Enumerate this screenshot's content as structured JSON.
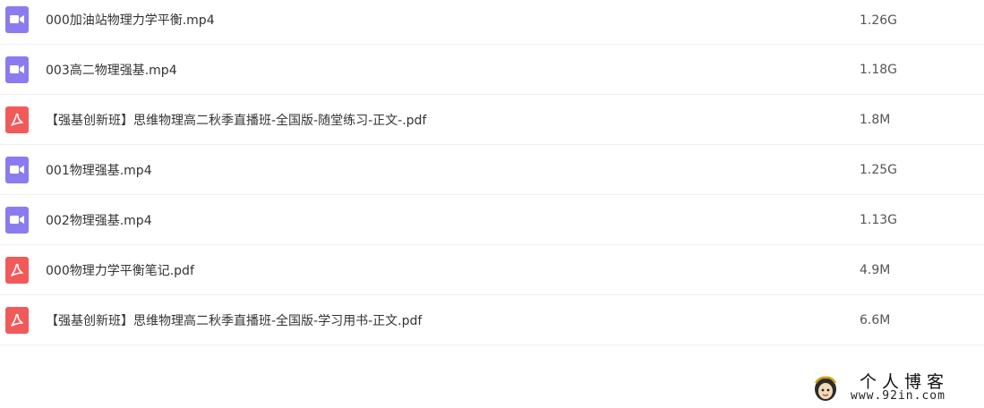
{
  "files": [
    {
      "type": "video",
      "icon": "video-file-icon",
      "name": "000加油站物理力学平衡.mp4",
      "size": "1.26G"
    },
    {
      "type": "video",
      "icon": "video-file-icon",
      "name": "003高二物理强基.mp4",
      "size": "1.18G"
    },
    {
      "type": "pdf",
      "icon": "pdf-file-icon",
      "name": "【强基创新班】思维物理高二秋季直播班-全国版-随堂练习-正文-.pdf",
      "size": "1.8M"
    },
    {
      "type": "video",
      "icon": "video-file-icon",
      "name": "001物理强基.mp4",
      "size": "1.25G"
    },
    {
      "type": "video",
      "icon": "video-file-icon",
      "name": "002物理强基.mp4",
      "size": "1.13G"
    },
    {
      "type": "pdf",
      "icon": "pdf-file-icon",
      "name": "000物理力学平衡笔记.pdf",
      "size": "4.9M"
    },
    {
      "type": "pdf",
      "icon": "pdf-file-icon",
      "name": "【强基创新班】思维物理高二秋季直播班-全国版-学习用书-正文.pdf",
      "size": "6.6M"
    }
  ],
  "watermark": {
    "title": "个人博客",
    "url": "www.92in.com"
  },
  "colors": {
    "video_icon": "#8a7cf0",
    "pdf_icon": "#f25a5a",
    "row_divider": "#eef0f4"
  }
}
